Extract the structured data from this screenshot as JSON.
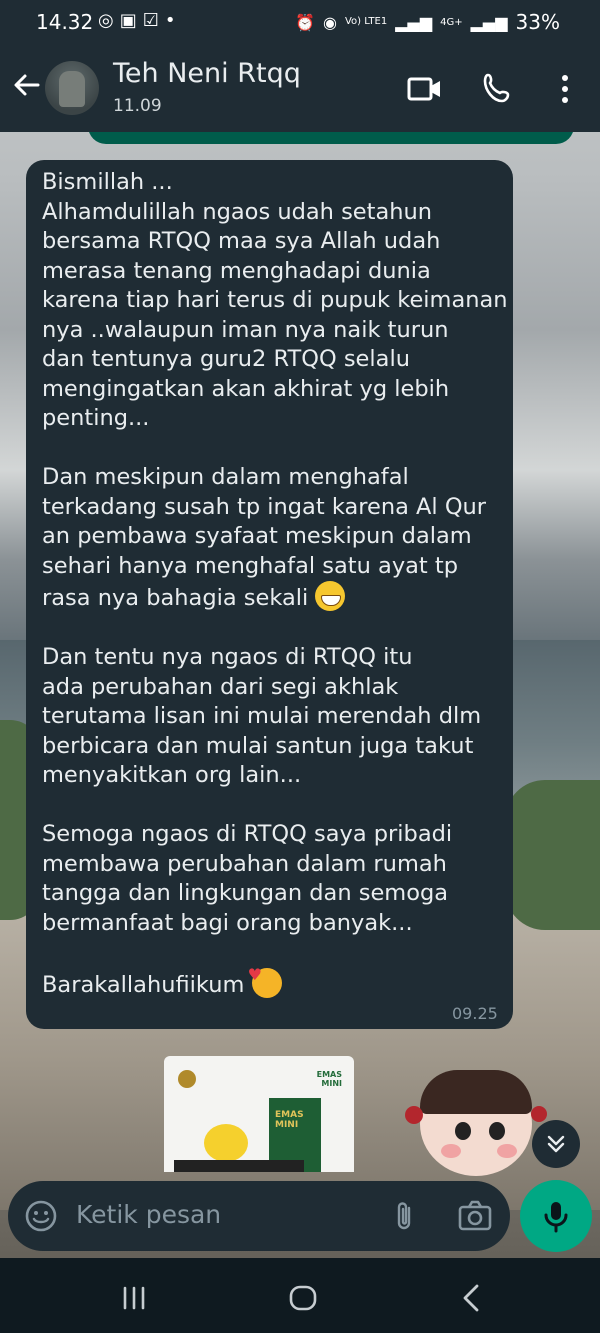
{
  "status_bar": {
    "time": "14.32",
    "left_icons": [
      "instagram-icon",
      "shopee-icon",
      "check-icon",
      "dot-icon"
    ],
    "network": "Vo) LTE1",
    "network2": "4G+",
    "battery": "33%"
  },
  "header": {
    "contact_name": "Teh Neni Rtqq",
    "last_seen": "11.09"
  },
  "message": {
    "text_before_grin": "Bismillah ...\nAlhamdulillah ngaos udah setahun\nbersama RTQQ maa sya Allah udah\nmerasa tenang menghadapi dunia\nkarena tiap hari terus di pupuk keimanan\nnya ..walaupun iman nya naik turun\ndan tentunya guru2 RTQQ selalu\nmengingatkan akan akhirat yg lebih\npenting...\n\nDan meskipun dalam menghafal\nterkadang susah tp ingat karena Al Qur\nan pembawa syafaat meskipun dalam\nsehari hanya menghafal satu ayat tp\nrasa nya bahagia sekali ",
    "text_after_grin": "\n\nDan tentu nya ngaos di RTQQ itu\nada perubahan dari segi akhlak\nterutama lisan ini mulai merendah dlm\nberbicara dan mulai santun juga takut\nmenyakitkan org lain...\n\nSemoga ngaos di RTQQ saya pribadi\nmembawa perubahan dalam rumah\ntangga dan lingkungan dan semoga\nbermanfaat bagi orang banyak...\n\nBarakallahufiikum ",
    "time": "09.25"
  },
  "card": {
    "brand": "EMAS\nMINI",
    "book_label": "EMAS\nMINI"
  },
  "input": {
    "placeholder": "Ketik pesan"
  },
  "colors": {
    "header_bg": "#1f2c34",
    "bubble_bg": "#1f2c34",
    "accent": "#00a884",
    "outgoing": "#005c4b"
  }
}
